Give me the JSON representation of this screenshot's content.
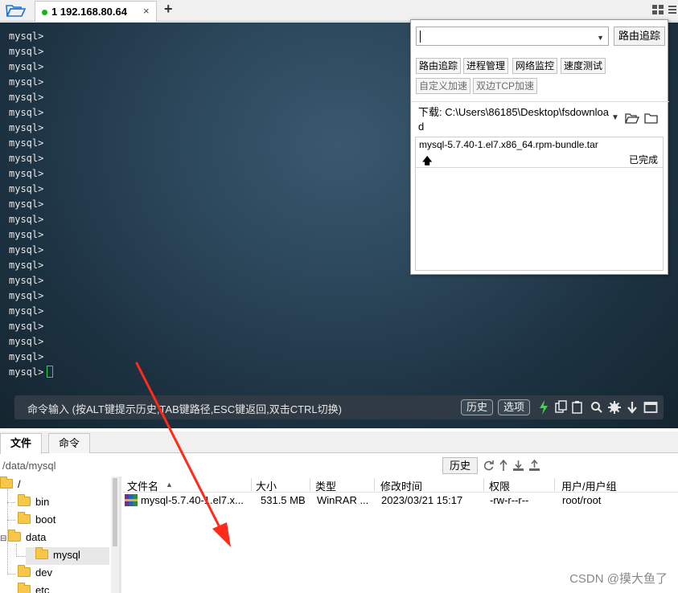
{
  "tabbar": {
    "tab_label": "1 192.168.80.64",
    "close_glyph": "×",
    "add_glyph": "+"
  },
  "terminal": {
    "prompt": "mysql>",
    "line_count": 23
  },
  "command_bar": {
    "placeholder": "命令输入 (按ALT键提示历史,TAB键路径,ESC键返回,双击CTRL切换)",
    "history_button": "历史",
    "options_button": "选项"
  },
  "popup": {
    "trace_button": "路由追踪",
    "tools": [
      "路由追踪",
      "进程管理",
      "网络监控",
      "速度测试"
    ],
    "accel": [
      "自定义加速",
      "双边TCP加速"
    ],
    "download_label": "下载: C:\\Users\\86185\\Desktop\\fsdownload",
    "download_item": {
      "name": "mysql-5.7.40-1.el7.x86_64.rpm-bundle.tar",
      "arrow": "🡅",
      "status": "已完成"
    }
  },
  "lower": {
    "tabs": [
      "文件",
      "命令"
    ],
    "path": "/data/mysql",
    "history_button": "历史",
    "tree": [
      {
        "label": "/"
      },
      {
        "label": "bin"
      },
      {
        "label": "boot"
      },
      {
        "label": "data"
      },
      {
        "label": "mysql"
      },
      {
        "label": "dev"
      },
      {
        "label": "etc"
      }
    ],
    "columns": [
      "文件名",
      "大小",
      "类型",
      "修改时间",
      "权限",
      "用户/用户组"
    ],
    "file": {
      "name": "mysql-5.7.40-1.el7.x...",
      "size": "531.5 MB",
      "type": "WinRAR ...",
      "modified": "2023/03/21 15:17",
      "perm": "-rw-r--r--",
      "owner": "root/root"
    }
  },
  "watermark": "CSDN @摸大鱼了",
  "colors": {
    "terminal_bg": "#2a4558",
    "cursor": "#2fd35a",
    "arrow": "#ff2a1a",
    "active_dot": "#1ab21a"
  }
}
